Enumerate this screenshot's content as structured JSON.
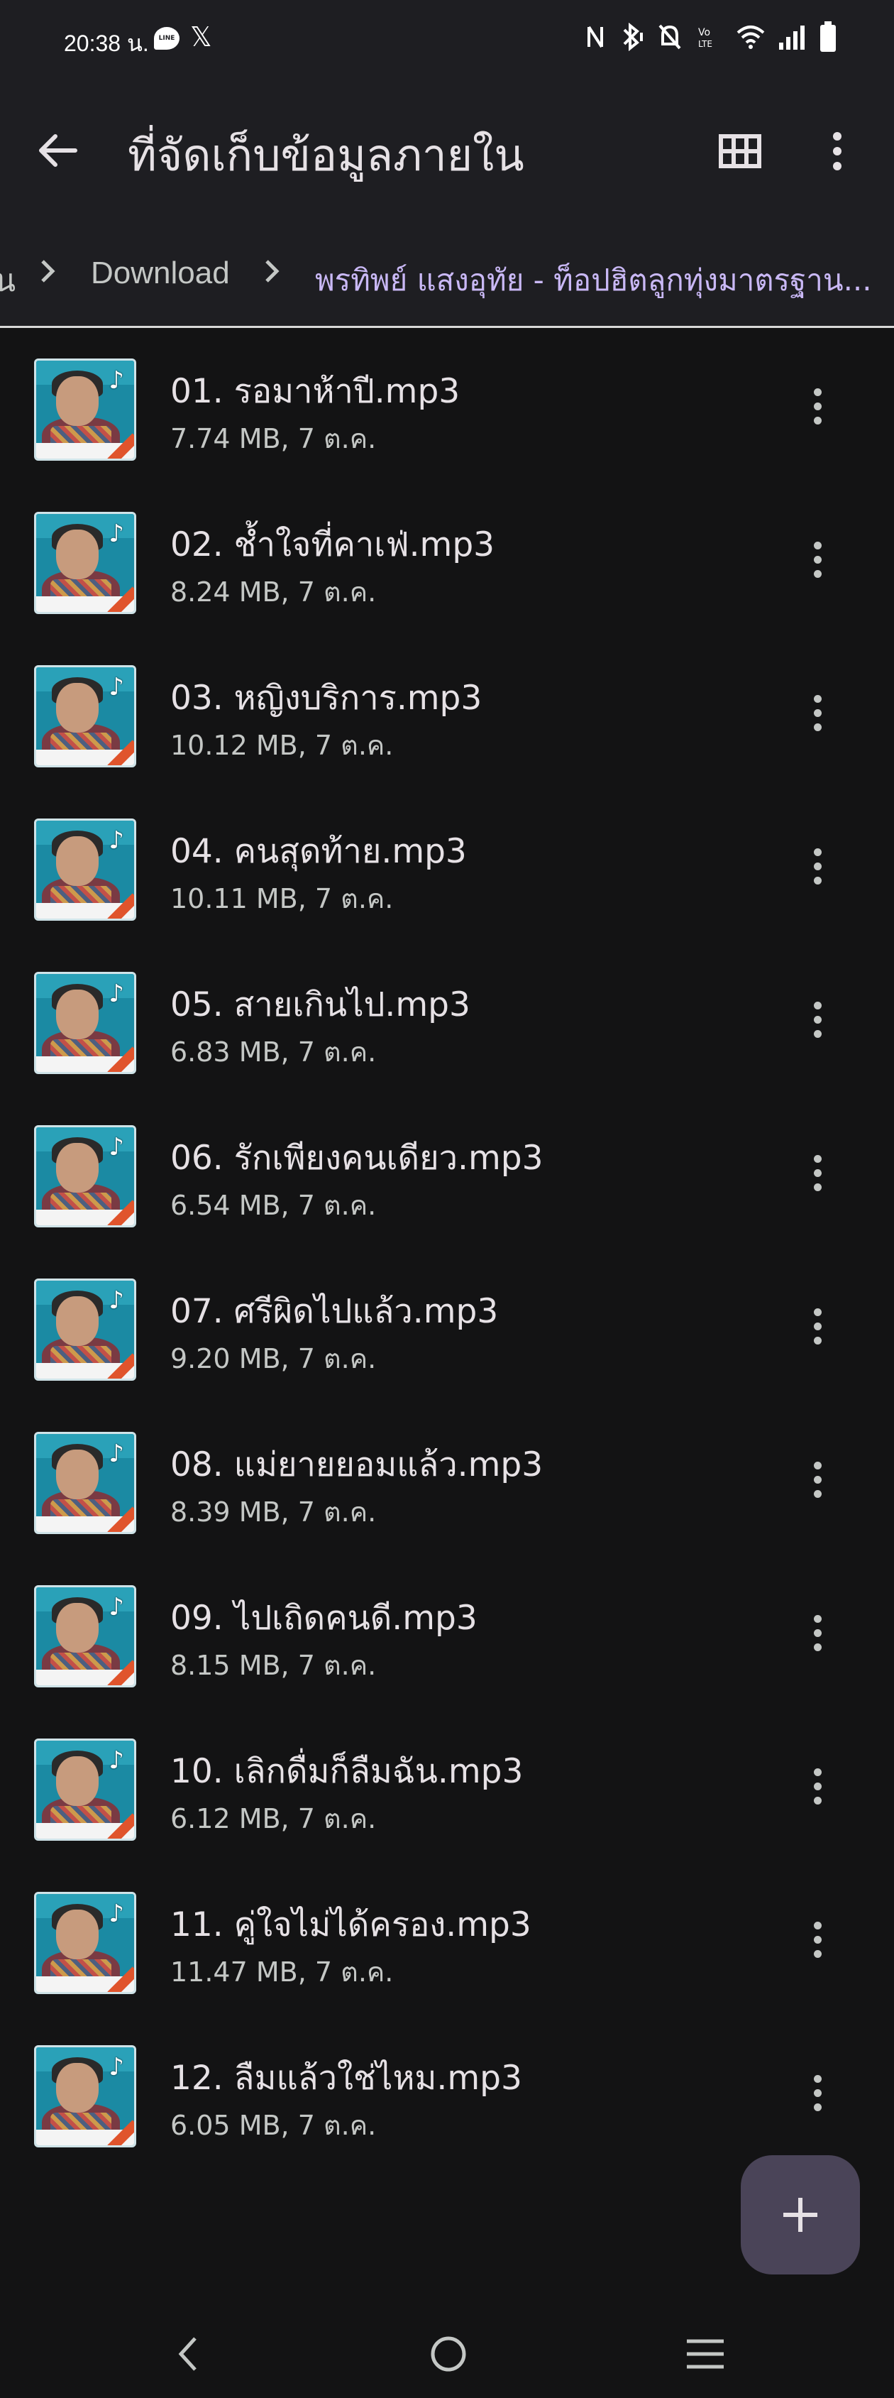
{
  "status_bar": {
    "time": "20:38 น.",
    "line_icon_text": "LINE",
    "x_icon": "𝕏"
  },
  "app_bar": {
    "title": "ที่จัดเก็บข้อมูลภายใน"
  },
  "breadcrumb": {
    "prev_fragment": "น",
    "download": "Download",
    "current": "พรทิพย์ แสงอุทัย - ท็อปฮิตลูกทุ่งมาตรฐาน..."
  },
  "files": [
    {
      "name": "01. รอมาห้าปี.mp3",
      "meta": "7.74 MB, 7 ต.ค."
    },
    {
      "name": "02. ช้ำใจที่คาเฟ่.mp3",
      "meta": "8.24 MB, 7 ต.ค."
    },
    {
      "name": "03. หญิงบริการ.mp3",
      "meta": "10.12 MB, 7 ต.ค."
    },
    {
      "name": "04. คนสุดท้าย.mp3",
      "meta": "10.11 MB, 7 ต.ค."
    },
    {
      "name": "05. สายเกินไป.mp3",
      "meta": "6.83 MB, 7 ต.ค."
    },
    {
      "name": "06. รักเพียงคนเดียว.mp3",
      "meta": "6.54 MB, 7 ต.ค."
    },
    {
      "name": "07. ศรีผิดไปแล้ว.mp3",
      "meta": "9.20 MB, 7 ต.ค."
    },
    {
      "name": "08. แม่ยายยอมแล้ว.mp3",
      "meta": "8.39 MB, 7 ต.ค."
    },
    {
      "name": "09. ไปเถิดคนดี.mp3",
      "meta": "8.15 MB, 7 ต.ค."
    },
    {
      "name": "10. เลิกดื่มก็ลืมฉัน.mp3",
      "meta": "6.12 MB, 7 ต.ค."
    },
    {
      "name": "11. คู่ใจไม่ได้ครอง.mp3",
      "meta": "11.47 MB, 7 ต.ค."
    },
    {
      "name": "12. ลืมแล้วใช่ไหม.mp3",
      "meta": "6.05 MB, 7 ต.ค."
    }
  ],
  "colors": {
    "background": "#131314",
    "surface": "#1e1e22",
    "accent": "#c9b8f5",
    "fab": "#4a4458"
  },
  "icons": {
    "back": "arrow-left-icon",
    "grid": "grid-view-icon",
    "more": "more-vert-icon",
    "fab": "plus-icon",
    "thumb": "album-art-icon"
  }
}
